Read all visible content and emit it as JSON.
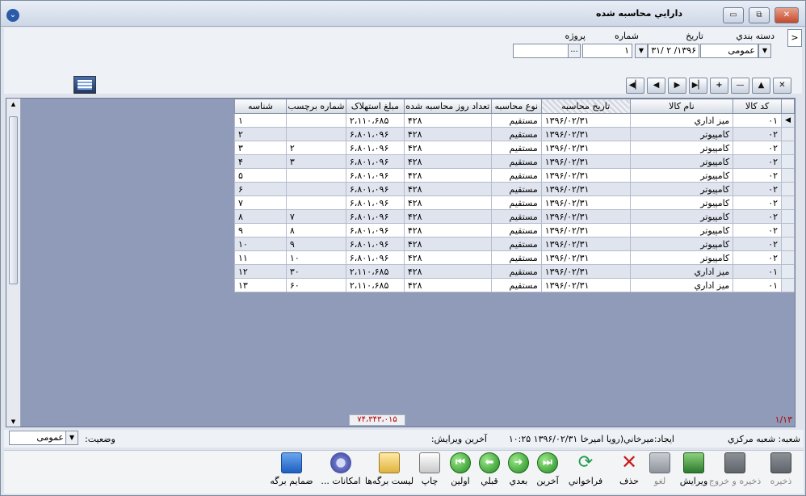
{
  "window": {
    "title": "دارايي محاسبه شده",
    "buttons": {
      "minimize": "▭",
      "maximize": "⧉",
      "close": "✕"
    }
  },
  "header": {
    "category_label": "دسته بندي",
    "category_value": "عمومی",
    "date_label": "تاريخ",
    "date_value": "۱۳۹۶/ ۲ /۳۱",
    "number_label": "شماره",
    "number_value": "۱",
    "project_label": "پروژه",
    "project_value": "",
    "project_browse": "...",
    "collapse_arrow": ">"
  },
  "navbar": [
    "◀▏",
    "◀",
    "▶",
    "▶▏",
    "+",
    "—",
    "▲",
    "✕"
  ],
  "grid": {
    "headers": {
      "code": "کد کالا",
      "name": "نام کالا",
      "calc_date": "تاريخ محاسبه",
      "calc_type": "نوع محاسبه",
      "days": "تعداد روز محاسبه شده",
      "amount": "مبلغ استهلاک",
      "label_no": "شماره برچسب",
      "id": "شناسه"
    },
    "rows": [
      {
        "code": "۰۱",
        "name": "ميز اداري",
        "date": "۱۳۹۶/۰۲/۳۱",
        "type": "مستقيم",
        "days": "۴۲۸",
        "amount": "۲،۱۱۰،۶۸۵",
        "label": "",
        "id": "۱"
      },
      {
        "code": "۰۲",
        "name": "کامپيوتر",
        "date": "۱۳۹۶/۰۲/۳۱",
        "type": "مستقيم",
        "days": "۴۲۸",
        "amount": "۶،۸۰۱،۰۹۶",
        "label": "",
        "id": "۲"
      },
      {
        "code": "۰۲",
        "name": "کامپيوتر",
        "date": "۱۳۹۶/۰۲/۳۱",
        "type": "مستقيم",
        "days": "۴۲۸",
        "amount": "۶،۸۰۱،۰۹۶",
        "label": "۲",
        "id": "۳"
      },
      {
        "code": "۰۲",
        "name": "کامپيوتر",
        "date": "۱۳۹۶/۰۲/۳۱",
        "type": "مستقيم",
        "days": "۴۲۸",
        "amount": "۶،۸۰۱،۰۹۶",
        "label": "۳",
        "id": "۴"
      },
      {
        "code": "۰۲",
        "name": "کامپيوتر",
        "date": "۱۳۹۶/۰۲/۳۱",
        "type": "مستقيم",
        "days": "۴۲۸",
        "amount": "۶،۸۰۱،۰۹۶",
        "label": "",
        "id": "۵"
      },
      {
        "code": "۰۲",
        "name": "کامپيوتر",
        "date": "۱۳۹۶/۰۲/۳۱",
        "type": "مستقيم",
        "days": "۴۲۸",
        "amount": "۶،۸۰۱،۰۹۶",
        "label": "",
        "id": "۶"
      },
      {
        "code": "۰۲",
        "name": "کامپيوتر",
        "date": "۱۳۹۶/۰۲/۳۱",
        "type": "مستقيم",
        "days": "۴۲۸",
        "amount": "۶،۸۰۱،۰۹۶",
        "label": "",
        "id": "۷"
      },
      {
        "code": "۰۲",
        "name": "کامپيوتر",
        "date": "۱۳۹۶/۰۲/۳۱",
        "type": "مستقيم",
        "days": "۴۲۸",
        "amount": "۶،۸۰۱،۰۹۶",
        "label": "۷",
        "id": "۸"
      },
      {
        "code": "۰۲",
        "name": "کامپيوتر",
        "date": "۱۳۹۶/۰۲/۳۱",
        "type": "مستقيم",
        "days": "۴۲۸",
        "amount": "۶،۸۰۱،۰۹۶",
        "label": "۸",
        "id": "۹"
      },
      {
        "code": "۰۲",
        "name": "کامپيوتر",
        "date": "۱۳۹۶/۰۲/۳۱",
        "type": "مستقيم",
        "days": "۴۲۸",
        "amount": "۶،۸۰۱،۰۹۶",
        "label": "۹",
        "id": "۱۰"
      },
      {
        "code": "۰۲",
        "name": "کامپيوتر",
        "date": "۱۳۹۶/۰۲/۳۱",
        "type": "مستقيم",
        "days": "۴۲۸",
        "amount": "۶،۸۰۱،۰۹۶",
        "label": "۱۰",
        "id": "۱۱"
      },
      {
        "code": "۰۱",
        "name": "ميز اداري",
        "date": "۱۳۹۶/۰۲/۳۱",
        "type": "مستقيم",
        "days": "۴۲۸",
        "amount": "۲،۱۱۰،۶۸۵",
        "label": "۳۰",
        "id": "۱۲"
      },
      {
        "code": "۰۱",
        "name": "ميز اداري",
        "date": "۱۳۹۶/۰۲/۳۱",
        "type": "مستقيم",
        "days": "۴۲۸",
        "amount": "۲،۱۱۰،۶۸۵",
        "label": "۶۰",
        "id": "۱۳"
      }
    ],
    "total": "۷۴،۳۴۳،۰۱۵",
    "pager": "۱/۱۳"
  },
  "status": {
    "branch": "شعبه: شعبه مرکزي",
    "created": "ايجاد:ميرخاني(رويا اميرخا  ۱۳۹۶/۰۲/۳۱  ۱۰:۲۵",
    "last_edit": "آخرين ويرايش:",
    "state_label": "وضعيت:",
    "state_value": "عمومی"
  },
  "toolbar": {
    "save": "ذخيره",
    "save_exit": "ذخيره و خروج",
    "edit": "ويرايش",
    "cancel": "لغو",
    "delete": "حذف",
    "recall": "فراخواني",
    "last": "آخرين",
    "next": "بعدي",
    "prev": "قبلي",
    "first": "اولين",
    "print": "چاپ",
    "sheet_list": "ليست برگه‌ها",
    "options": "امکانات ...",
    "attachments": "ضمايم برگه"
  }
}
